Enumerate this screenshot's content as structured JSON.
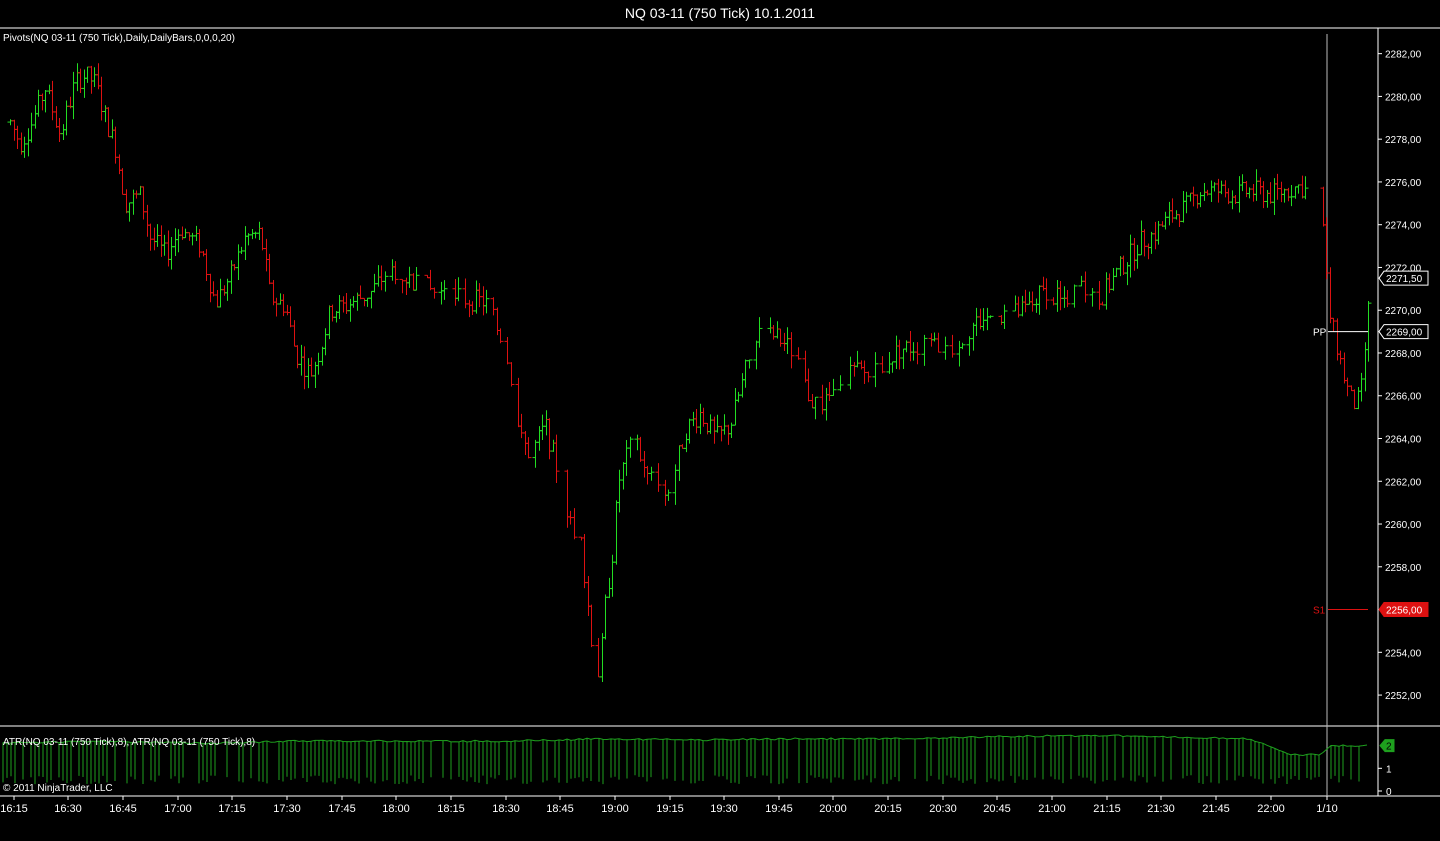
{
  "window": {
    "title": "NQ 03-11 (750 Tick)  10.1.2011"
  },
  "colors": {
    "up": "#22dd22",
    "down": "#dd1111",
    "atr": "#1ea01e",
    "pivot": "#ffffff",
    "s1": "#dd1111",
    "grid": "#ffffff"
  },
  "price_panel": {
    "indicator_label": "Pivots(NQ 03-11 (750 Tick),Daily,DailyBars,0,0,0,20)",
    "ylim": [
      2250.6,
      2283.2
    ],
    "ticks": [
      "2252,00",
      "2254,00",
      "2256,00",
      "2258,00",
      "2260,00",
      "2262,00",
      "2264,00",
      "2266,00",
      "2268,00",
      "2270,00",
      "2272,00",
      "2274,00",
      "2276,00",
      "2278,00",
      "2280,00",
      "2282,00"
    ],
    "last_price_label": "2271,50",
    "last_price_value": 2271.5,
    "pivot_pp": {
      "label": "PP",
      "value": 2269.0,
      "price_label": "2269,00"
    },
    "pivot_s1": {
      "label": "S1",
      "value": 2256.0,
      "price_label": "2256,00"
    }
  },
  "atr_panel": {
    "indicator_label": "ATR(NQ 03-11 (750 Tick),8), ATR(NQ 03-11 (750 Tick),8)",
    "ticks": [
      "0",
      "1"
    ],
    "ylim": [
      0,
      2.6
    ],
    "last_value_label": "2"
  },
  "x_axis": {
    "ticks": [
      "16:15",
      "16:30",
      "16:45",
      "17:00",
      "17:15",
      "17:30",
      "17:45",
      "18:00",
      "18:15",
      "18:30",
      "18:45",
      "19:00",
      "19:15",
      "19:30",
      "19:45",
      "20:00",
      "20:15",
      "20:30",
      "20:45",
      "21:00",
      "21:15",
      "21:30",
      "21:45",
      "22:00",
      "1/10"
    ]
  },
  "footer": {
    "copyright": "© 2011 NinjaTrader, LLC"
  },
  "chart_data": {
    "type": "ohlc",
    "title": "NQ 03-11 (750 Tick)  10.1.2011",
    "keypoints": [
      [
        0,
        2279.8
      ],
      [
        20,
        2277.8
      ],
      [
        30,
        2278.6
      ],
      [
        45,
        2280.4
      ],
      [
        60,
        2278.2
      ],
      [
        75,
        2280.7
      ],
      [
        85,
        2281.0
      ],
      [
        95,
        2280.6
      ],
      [
        105,
        2279.0
      ],
      [
        115,
        2277.6
      ],
      [
        125,
        2275.0
      ],
      [
        140,
        2275.4
      ],
      [
        150,
        2273.4
      ],
      [
        165,
        2272.6
      ],
      [
        180,
        2273.8
      ],
      [
        200,
        2273.0
      ],
      [
        215,
        2270.3
      ],
      [
        230,
        2271.6
      ],
      [
        245,
        2273.4
      ],
      [
        260,
        2273.6
      ],
      [
        270,
        2270.6
      ],
      [
        285,
        2270.2
      ],
      [
        295,
        2268.0
      ],
      [
        310,
        2267.0
      ],
      [
        320,
        2268.2
      ],
      [
        330,
        2270.0
      ],
      [
        345,
        2270.2
      ],
      [
        360,
        2270.6
      ],
      [
        370,
        2270.8
      ],
      [
        390,
        2272.0
      ],
      [
        410,
        2271.4
      ],
      [
        445,
        2270.6
      ],
      [
        485,
        2270.4
      ],
      [
        500,
        2268.8
      ],
      [
        510,
        2267.0
      ],
      [
        520,
        2264.0
      ],
      [
        530,
        2263.2
      ],
      [
        545,
        2264.6
      ],
      [
        560,
        2262.0
      ],
      [
        570,
        2260.0
      ],
      [
        580,
        2259.4
      ],
      [
        590,
        2255.0
      ],
      [
        595,
        2252.6
      ],
      [
        600,
        2253.4
      ],
      [
        605,
        2256.2
      ],
      [
        612,
        2258.6
      ],
      [
        618,
        2262.0
      ],
      [
        625,
        2263.0
      ],
      [
        635,
        2264.2
      ],
      [
        645,
        2262.2
      ],
      [
        660,
        2262.0
      ],
      [
        665,
        2260.8
      ],
      [
        675,
        2262.6
      ],
      [
        685,
        2264.4
      ],
      [
        700,
        2265.2
      ],
      [
        715,
        2264.0
      ],
      [
        730,
        2264.6
      ],
      [
        745,
        2267.2
      ],
      [
        760,
        2268.8
      ],
      [
        775,
        2268.8
      ],
      [
        790,
        2268.2
      ],
      [
        810,
        2265.8
      ],
      [
        825,
        2265.6
      ],
      [
        845,
        2267.2
      ],
      [
        870,
        2267.0
      ],
      [
        900,
        2268.2
      ],
      [
        925,
        2268.4
      ],
      [
        950,
        2268.2
      ],
      [
        975,
        2269.4
      ],
      [
        995,
        2269.8
      ],
      [
        1010,
        2269.8
      ],
      [
        1025,
        2270.0
      ],
      [
        1045,
        2271.0
      ],
      [
        1060,
        2270.4
      ],
      [
        1080,
        2271.0
      ],
      [
        1100,
        2270.6
      ],
      [
        1120,
        2272.0
      ],
      [
        1140,
        2273.2
      ],
      [
        1155,
        2273.6
      ],
      [
        1170,
        2274.4
      ],
      [
        1185,
        2274.8
      ],
      [
        1200,
        2275.6
      ],
      [
        1215,
        2275.6
      ],
      [
        1235,
        2275.4
      ],
      [
        1250,
        2275.6
      ],
      [
        1270,
        2275.4
      ],
      [
        1285,
        2275.6
      ],
      [
        1300,
        2275.8
      ],
      [
        1315,
        2275.2
      ],
      [
        1322,
        2274.2
      ],
      [
        1328,
        2270.0
      ],
      [
        1335,
        2268.6
      ],
      [
        1345,
        2266.6
      ],
      [
        1352,
        2265.6
      ],
      [
        1360,
        2265.8
      ],
      [
        1368,
        2270.0
      ],
      [
        1372,
        2271.5
      ]
    ],
    "atr_levels": [
      [
        0,
        2.1
      ],
      [
        100,
        2.2
      ],
      [
        200,
        2.1
      ],
      [
        300,
        2.2
      ],
      [
        400,
        2.2
      ],
      [
        500,
        2.2
      ],
      [
        600,
        2.3
      ],
      [
        700,
        2.25
      ],
      [
        800,
        2.3
      ],
      [
        900,
        2.3
      ],
      [
        1000,
        2.4
      ],
      [
        1100,
        2.45
      ],
      [
        1150,
        2.4
      ],
      [
        1250,
        2.3
      ],
      [
        1290,
        1.6
      ],
      [
        1320,
        1.6
      ],
      [
        1330,
        2.0
      ],
      [
        1370,
        2.0
      ]
    ]
  }
}
